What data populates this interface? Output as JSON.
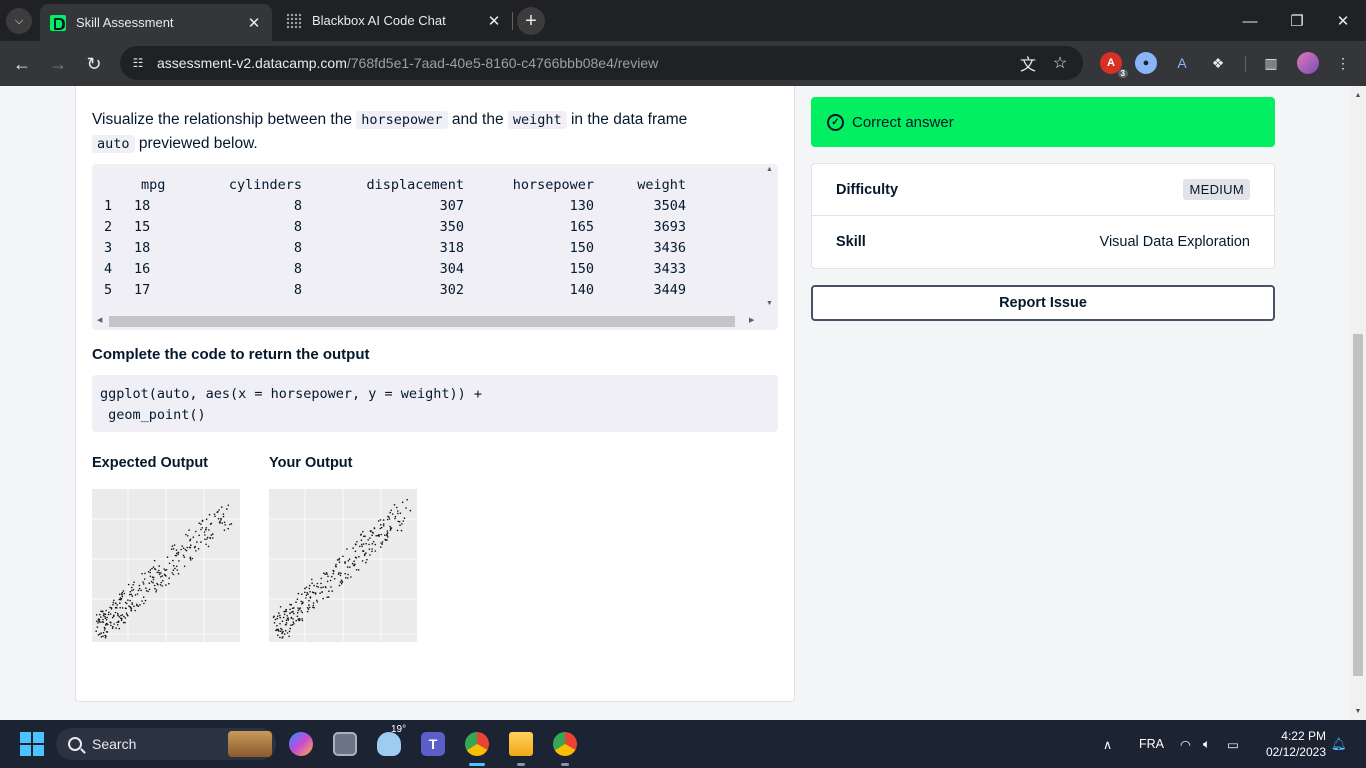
{
  "browser": {
    "tabs": [
      {
        "title": "Skill Assessment",
        "active": true
      },
      {
        "title": "Blackbox AI Code Chat",
        "active": false
      }
    ],
    "url_host": "assessment-v2.datacamp.com",
    "url_path": "/768fd5e1-7aad-40e5-8160-c4766bbb08e4/review",
    "extension_badge": "3"
  },
  "question": {
    "prompt_parts": [
      "Visualize the relationship between the",
      "horsepower",
      "and the",
      "weight",
      "in the data frame",
      "auto",
      "previewed below."
    ],
    "table": {
      "headers": [
        "",
        "mpg",
        "cylinders",
        "displacement",
        "horsepower",
        "weight"
      ],
      "rows": [
        [
          "1",
          "18",
          "8",
          "307",
          "130",
          "3504"
        ],
        [
          "2",
          "15",
          "8",
          "350",
          "165",
          "3693"
        ],
        [
          "3",
          "18",
          "8",
          "318",
          "150",
          "3436"
        ],
        [
          "4",
          "16",
          "8",
          "304",
          "150",
          "3433"
        ],
        [
          "5",
          "17",
          "8",
          "302",
          "140",
          "3449"
        ]
      ]
    },
    "code_title": "Complete the code to return the output",
    "code_lines": [
      "ggplot(auto, aes(x = horsepower, y = weight)) +",
      " geom_point()"
    ],
    "expected_label": "Expected Output",
    "your_label": "Your Output"
  },
  "result": {
    "status": "Correct answer",
    "difficulty_label": "Difficulty",
    "difficulty_value": "MEDIUM",
    "skill_label": "Skill",
    "skill_value": "Visual Data Exploration",
    "report_label": "Report Issue"
  },
  "taskbar": {
    "search_label": "Search",
    "weather_temp": "19°",
    "language": "FRA",
    "time": "4:22 PM",
    "date": "02/12/2023"
  },
  "colors": {
    "accent": "#03ef62",
    "text": "#05192d",
    "code_bg": "#efeff5"
  }
}
